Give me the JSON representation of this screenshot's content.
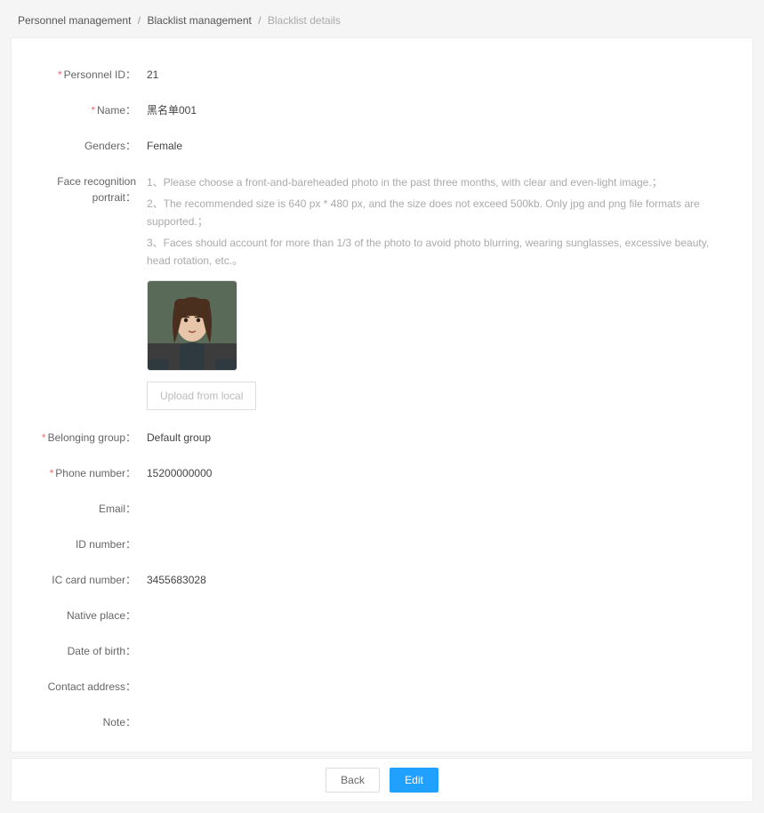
{
  "breadcrumb": {
    "item1": "Personnel management",
    "item2": "Blacklist management",
    "item3": "Blacklist details",
    "sep": "/"
  },
  "labels": {
    "personnel_id": "Personnel ID：",
    "name": "Name：",
    "genders": "Genders：",
    "face_portrait": "Face recognition portrait：",
    "belonging_group": "Belonging group：",
    "phone_number": "Phone number：",
    "email": "Email：",
    "id_number": "ID number：",
    "ic_card_number": "IC card number：",
    "native_place": "Native place：",
    "date_of_birth": "Date of birth：",
    "contact_address": "Contact address：",
    "note": "Note："
  },
  "values": {
    "personnel_id": "21",
    "name": "黑名单001",
    "genders": "Female",
    "belonging_group": "Default group",
    "phone_number": "15200000000",
    "email": "",
    "id_number": "",
    "ic_card_number": "3455683028",
    "native_place": "",
    "date_of_birth": "",
    "contact_address": "",
    "note": ""
  },
  "hints": {
    "h1": "1、Please choose a front-and-bareheaded photo in the past three months, with clear and even-light image.；",
    "h2": "2、The recommended size is 640 px * 480 px, and the size does not exceed 500kb. Only jpg and png file formats are supported.；",
    "h3": "3、Faces should account for more than 1/3 of the photo to avoid photo blurring, wearing sunglasses, excessive beauty, head rotation, etc.。"
  },
  "buttons": {
    "upload": "Upload from local",
    "back": "Back",
    "edit": "Edit"
  },
  "portrait": {
    "alt": "portrait-photo"
  }
}
